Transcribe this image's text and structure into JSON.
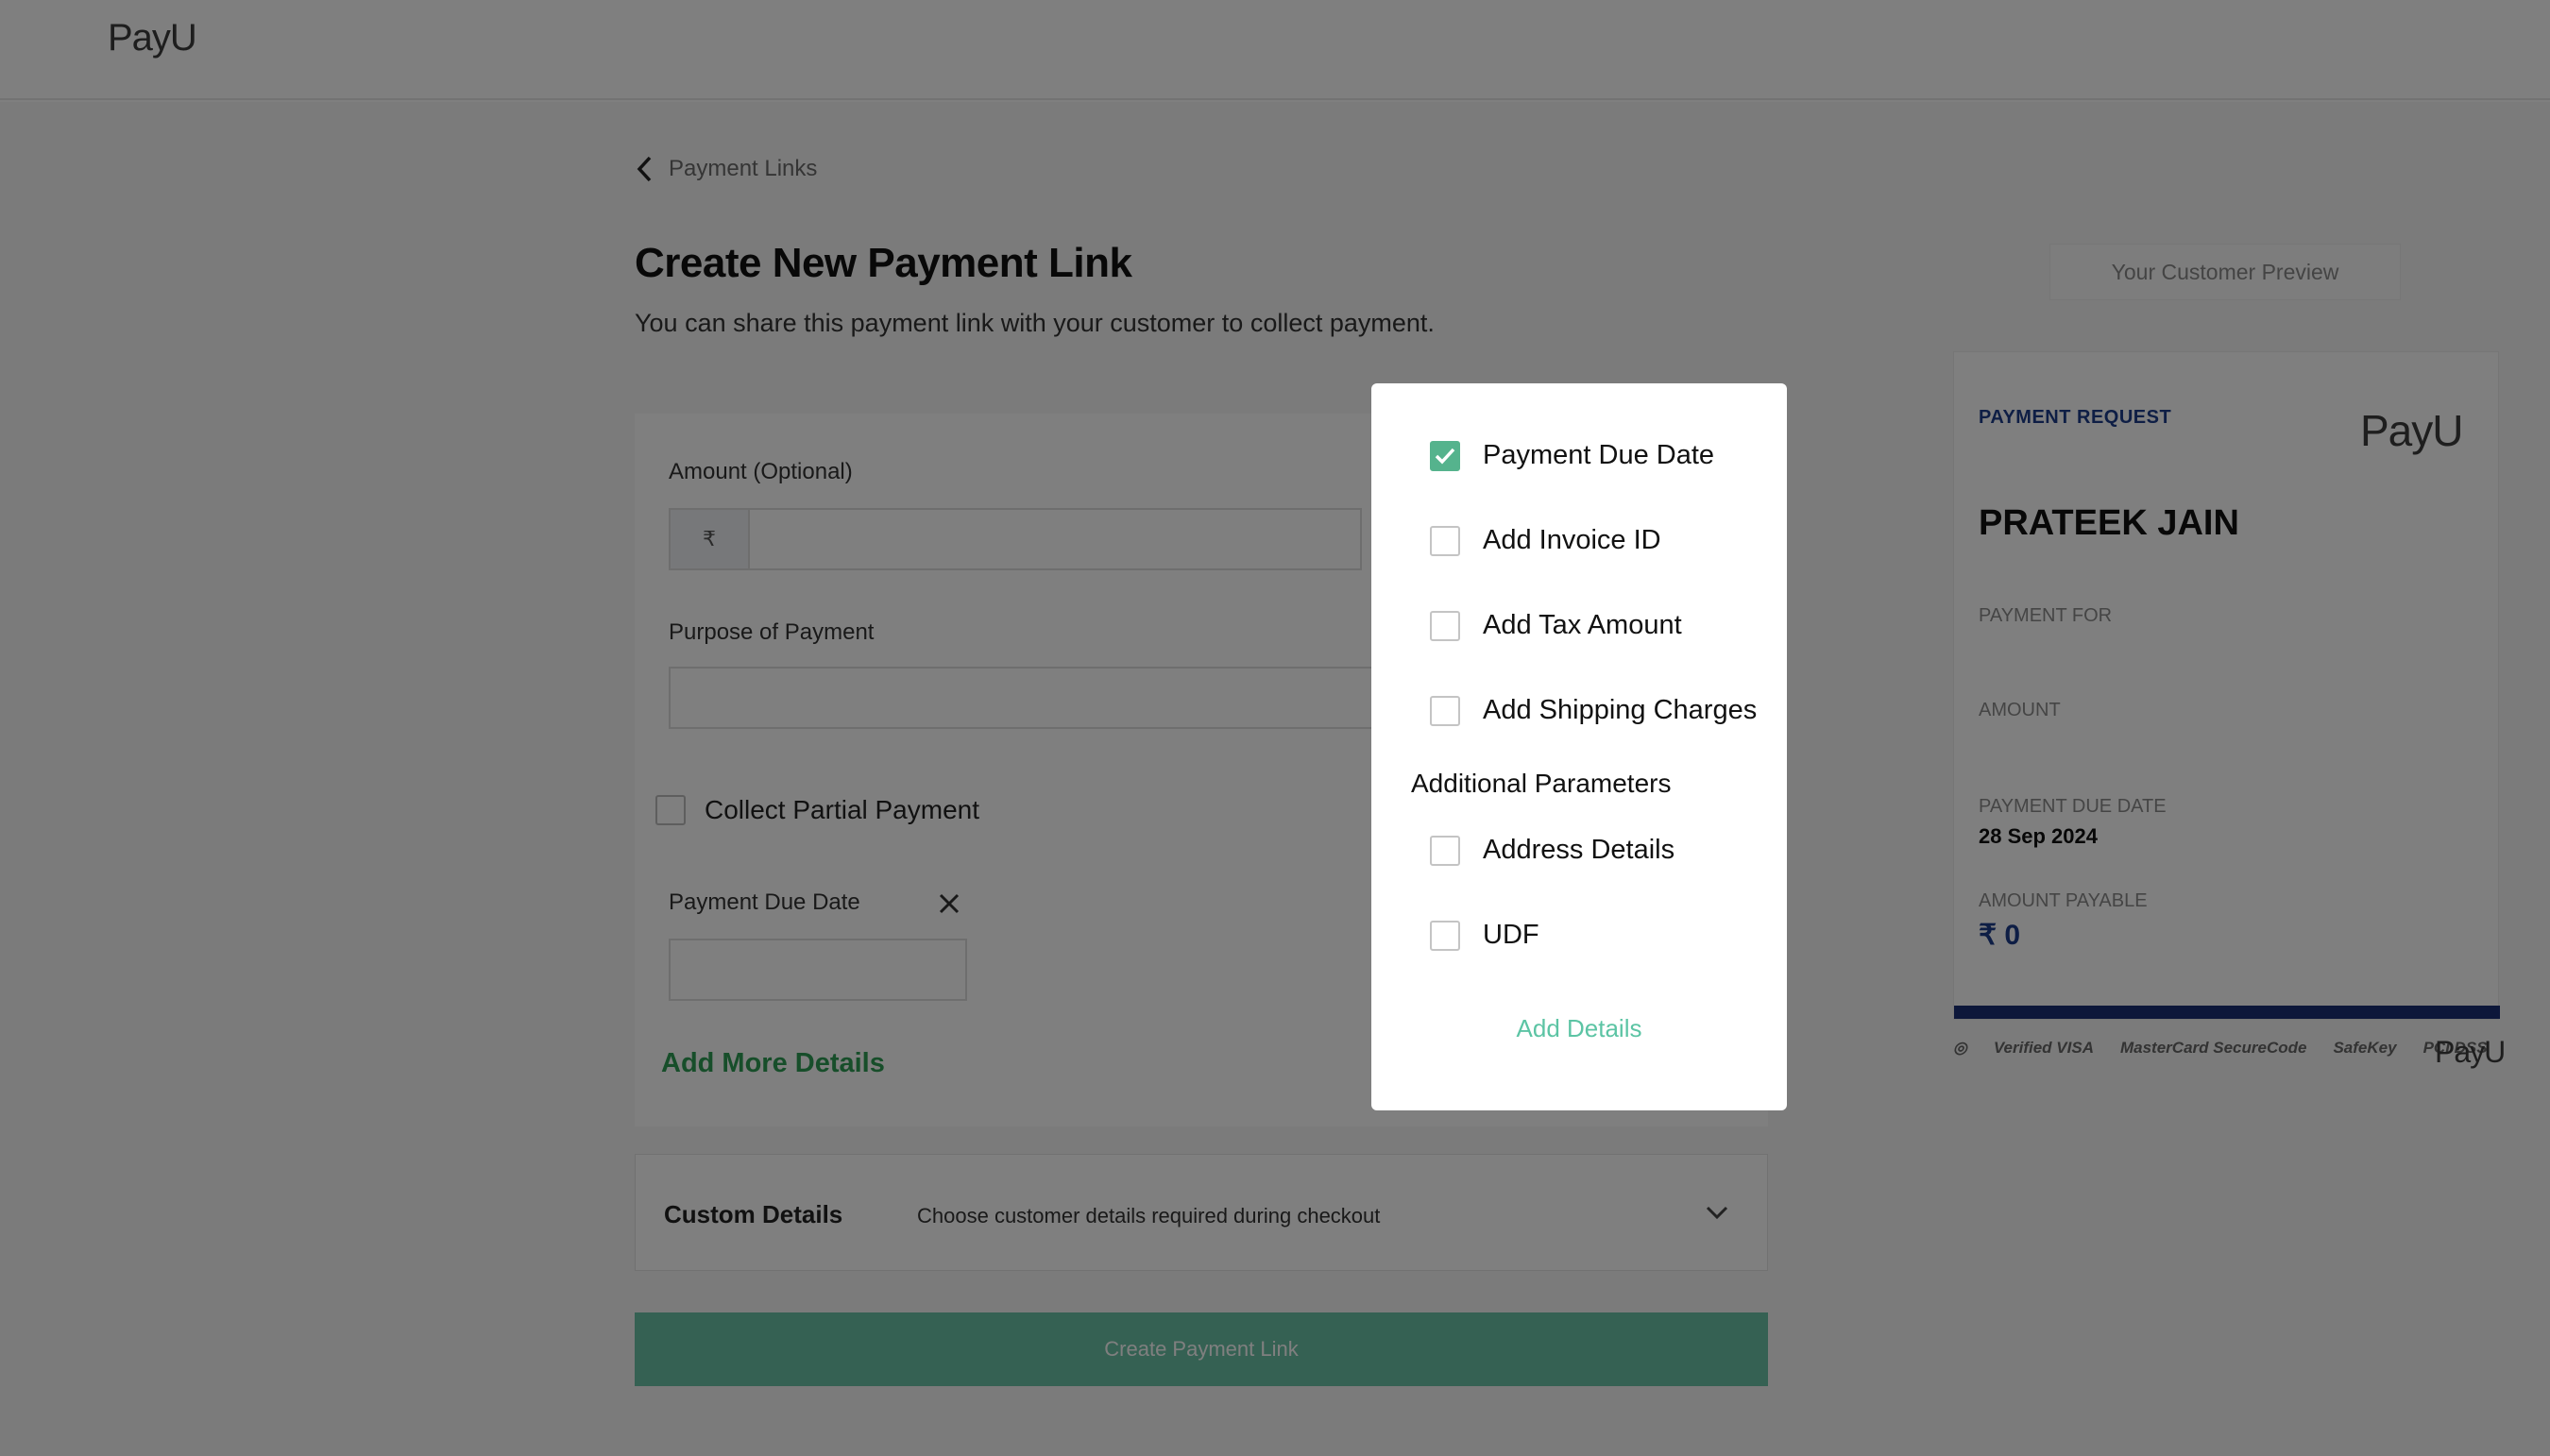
{
  "header": {
    "logo": "PayU"
  },
  "breadcrumb": {
    "back_label": "Payment Links"
  },
  "page": {
    "title": "Create New Payment Link",
    "subtitle": "You can share this payment link with your customer to collect payment."
  },
  "form": {
    "amount_label": "Amount (Optional)",
    "currency_symbol": "₹",
    "purpose_label": "Purpose of Payment",
    "partial_label": "Collect Partial Payment",
    "due_date_label": "Payment Due Date",
    "add_more_label": "Add More Details"
  },
  "custom_details": {
    "heading": "Custom Details",
    "description": "Choose customer details required during checkout"
  },
  "create_button": "Create Payment Link",
  "preview": {
    "button": "Your Customer Preview",
    "request_label": "PAYMENT REQUEST",
    "logo": "PayU",
    "customer_name": "PRATEEK JAIN",
    "payment_for_label": "PAYMENT FOR",
    "amount_label": "AMOUNT",
    "due_date_label": "PAYMENT DUE DATE",
    "due_date_value": "28 Sep 2024",
    "amount_payable_label": "AMOUNT PAYABLE",
    "amount_payable_value": "₹ 0",
    "footer_logo": "PayU",
    "badges": [
      "Verified VISA",
      "MasterCard SecureCode",
      "SafeKey",
      "PCI DSS"
    ]
  },
  "modal": {
    "options": [
      {
        "label": "Payment Due Date",
        "checked": true
      },
      {
        "label": "Add Invoice ID",
        "checked": false
      },
      {
        "label": "Add Tax Amount",
        "checked": false
      },
      {
        "label": "Add Shipping Charges",
        "checked": false
      }
    ],
    "section_title": "Additional Parameters",
    "extra_options": [
      {
        "label": "Address Details",
        "checked": false
      },
      {
        "label": "UDF",
        "checked": false
      }
    ],
    "action_label": "Add Details"
  },
  "colors": {
    "accent_green": "#55b38d",
    "brand_blue": "#1d3c8a",
    "button_green": "#6bc3a6"
  }
}
